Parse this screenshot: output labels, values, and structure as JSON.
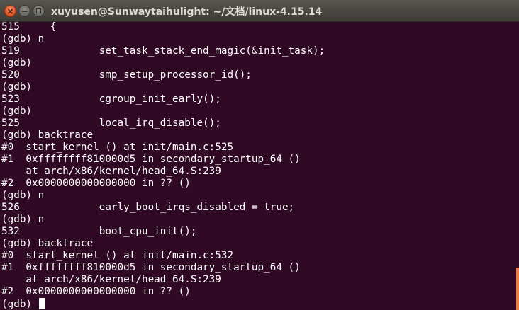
{
  "window": {
    "title": "xuyusen@Sunwaytaihulight: ~/文档/linux-4.15.14",
    "controls": {
      "close_glyph": "×",
      "minimize_glyph": "−"
    }
  },
  "terminal": {
    "lines": [
      "515     {",
      "(gdb) n",
      "519             set_task_stack_end_magic(&init_task);",
      "(gdb)",
      "520             smp_setup_processor_id();",
      "(gdb)",
      "523             cgroup_init_early();",
      "(gdb)",
      "525             local_irq_disable();",
      "(gdb) backtrace",
      "#0  start_kernel () at init/main.c:525",
      "#1  0xffffffff810000d5 in secondary_startup_64 ()",
      "    at arch/x86/kernel/head_64.S:239",
      "#2  0x0000000000000000 in ?? ()",
      "(gdb) n",
      "526             early_boot_irqs_disabled = true;",
      "(gdb) n",
      "532             boot_cpu_init();",
      "(gdb) backtrace",
      "#0  start_kernel () at init/main.c:532",
      "#1  0xffffffff810000d5 in secondary_startup_64 ()",
      "    at arch/x86/kernel/head_64.S:239",
      "#2  0x0000000000000000 in ?? ()"
    ],
    "prompt": "(gdb) ",
    "colors": {
      "background": "#300a24",
      "foreground": "#ffffff",
      "scrollbar": "#f07746"
    }
  }
}
